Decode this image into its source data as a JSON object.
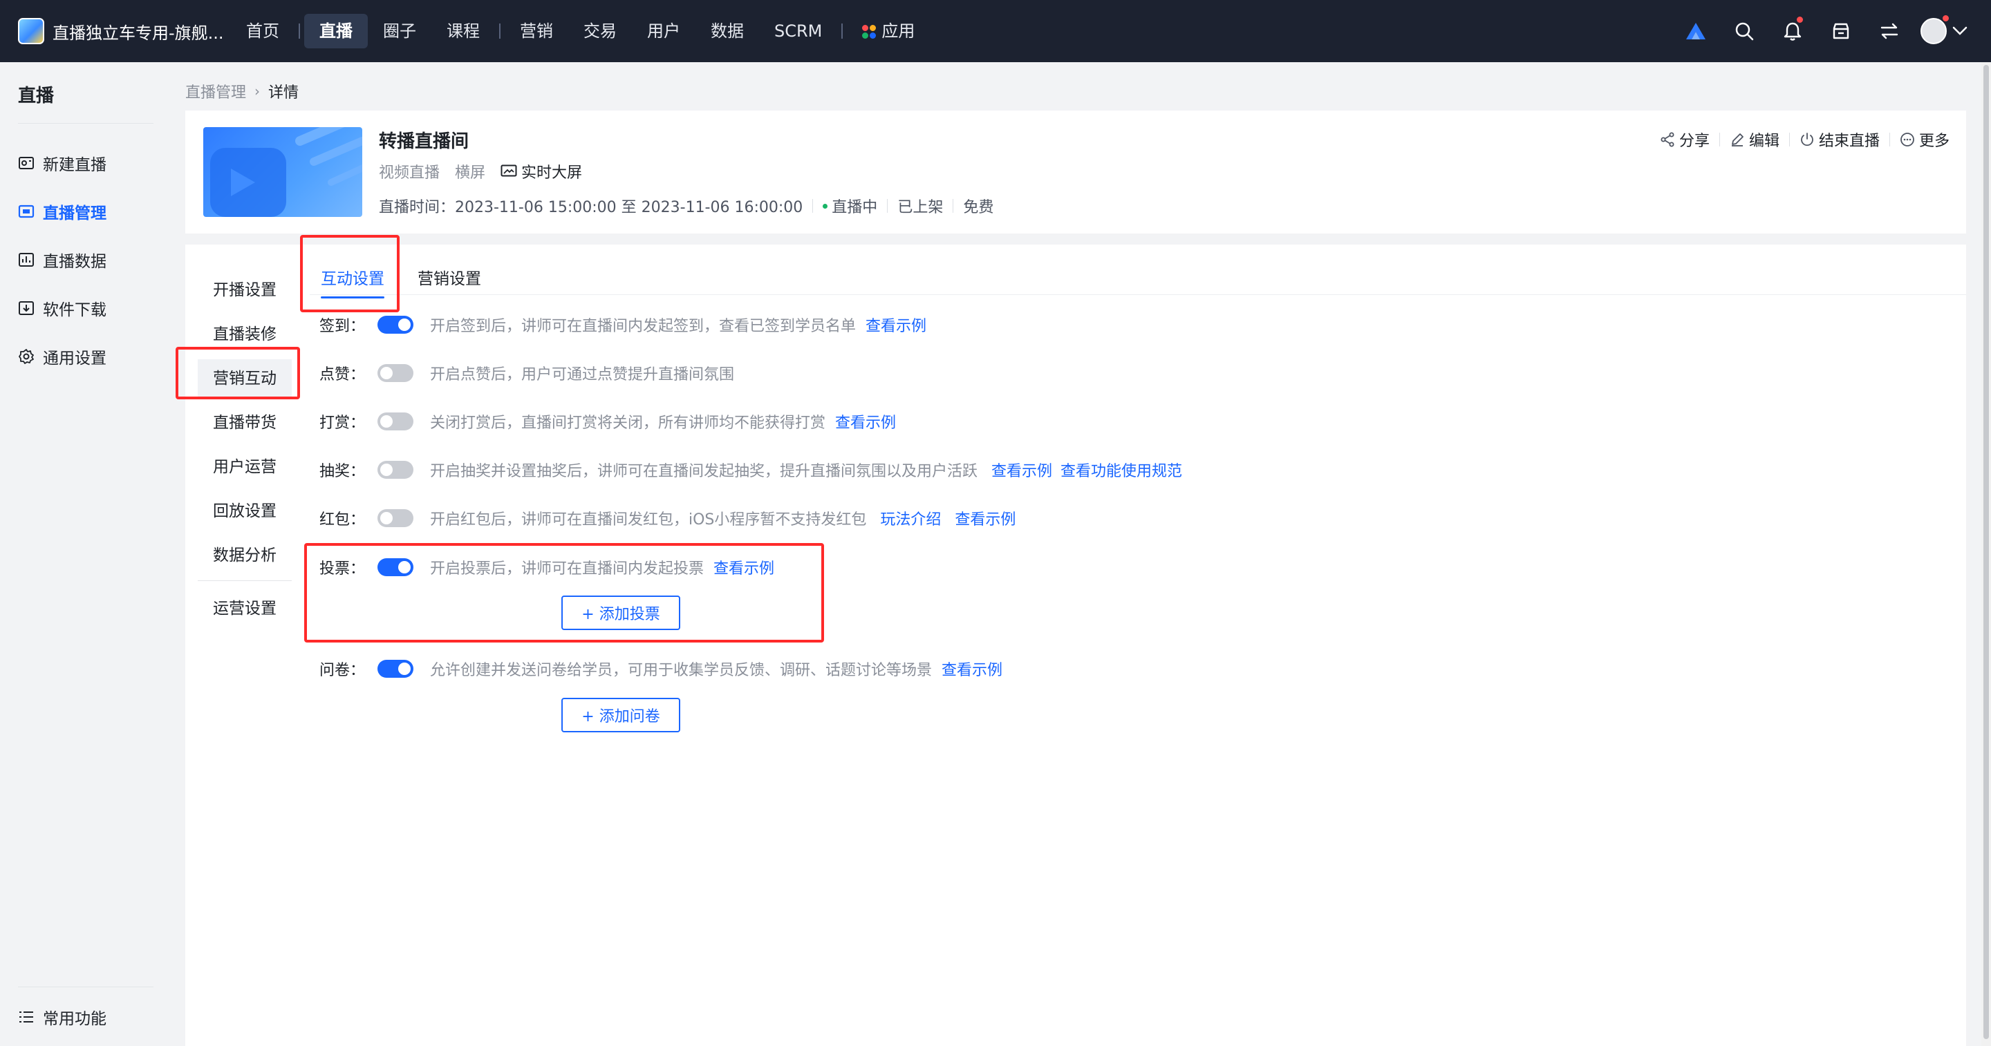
{
  "topbar": {
    "brand_name": "直播独立车专用-旗舰...",
    "nav": [
      "首页",
      "直播",
      "圈子",
      "课程",
      "营销",
      "交易",
      "用户",
      "数据",
      "SCRM",
      "应用"
    ],
    "active_nav": "直播",
    "right_icons": [
      "brand-a-icon",
      "search-icon",
      "bell-icon",
      "store-icon",
      "switch-icon",
      "avatar"
    ],
    "colors": {
      "bar": "#1c2230",
      "accent": "#1a66ff",
      "notify_dot": "#ff4d4f"
    }
  },
  "sidebar": {
    "title": "直播",
    "items": [
      {
        "label": "新建直播",
        "icon": "new-live-icon"
      },
      {
        "label": "直播管理",
        "icon": "live-manage-icon",
        "active": true
      },
      {
        "label": "直播数据",
        "icon": "live-data-icon"
      },
      {
        "label": "软件下载",
        "icon": "download-icon"
      },
      {
        "label": "通用设置",
        "icon": "gear-icon"
      }
    ],
    "bottom": {
      "label": "常用功能",
      "icon": "list-icon"
    }
  },
  "breadcrumb": {
    "parent": "直播管理",
    "current": "详情"
  },
  "live": {
    "title": "转播直播间",
    "type": "视频直播",
    "orientation": "横屏",
    "bigscreen": "实时大屏",
    "time": "直播时间：2023-11-06 15:00:00 至 2023-11-06 16:00:00",
    "status": "直播中",
    "shelf": "已上架",
    "price": "免费",
    "actions": {
      "share": "分享",
      "edit": "编辑",
      "end": "结束直播",
      "more": "更多"
    }
  },
  "inner_nav": {
    "group1": [
      "开播设置",
      "直播装修",
      "营销互动",
      "直播带货",
      "用户运营",
      "回放设置",
      "数据分析"
    ],
    "active": "营销互动",
    "group2": [
      "运营设置"
    ]
  },
  "tabs": {
    "interaction": "互动设置",
    "marketing": "营销设置",
    "active": "互动设置"
  },
  "settings": {
    "signin": {
      "label": "签到：",
      "on": true,
      "desc": "开启签到后，讲师可在直播间内发起签到，查看已签到学员名单",
      "link1": "查看示例"
    },
    "like": {
      "label": "点赞：",
      "on": false,
      "desc": "开启点赞后，用户可通过点赞提升直播间氛围"
    },
    "reward": {
      "label": "打赏：",
      "on": false,
      "desc": "关闭打赏后，直播间打赏将关闭，所有讲师均不能获得打赏",
      "link1": "查看示例"
    },
    "lottery": {
      "label": "抽奖：",
      "on": false,
      "desc": "开启抽奖并设置抽奖后，讲师可在直播间发起抽奖，提升直播间氛围以及用户活跃",
      "link1": "查看示例",
      "link2": "查看功能使用规范"
    },
    "redpacket": {
      "label": "红包：",
      "on": false,
      "desc": "开启红包后，讲师可在直播间发红包，iOS小程序暂不支持发红包",
      "link1": "玩法介绍",
      "link2": "查看示例"
    },
    "vote": {
      "label": "投票：",
      "on": true,
      "desc": "开启投票后，讲师可在直播间内发起投票",
      "link1": "查看示例",
      "button": "+ 添加投票"
    },
    "survey": {
      "label": "问卷：",
      "on": true,
      "desc": "允许创建并发送问卷给学员，可用于收集学员反馈、调研、话题讨论等场景",
      "link1": "查看示例",
      "button": "+ 添加问卷"
    }
  }
}
